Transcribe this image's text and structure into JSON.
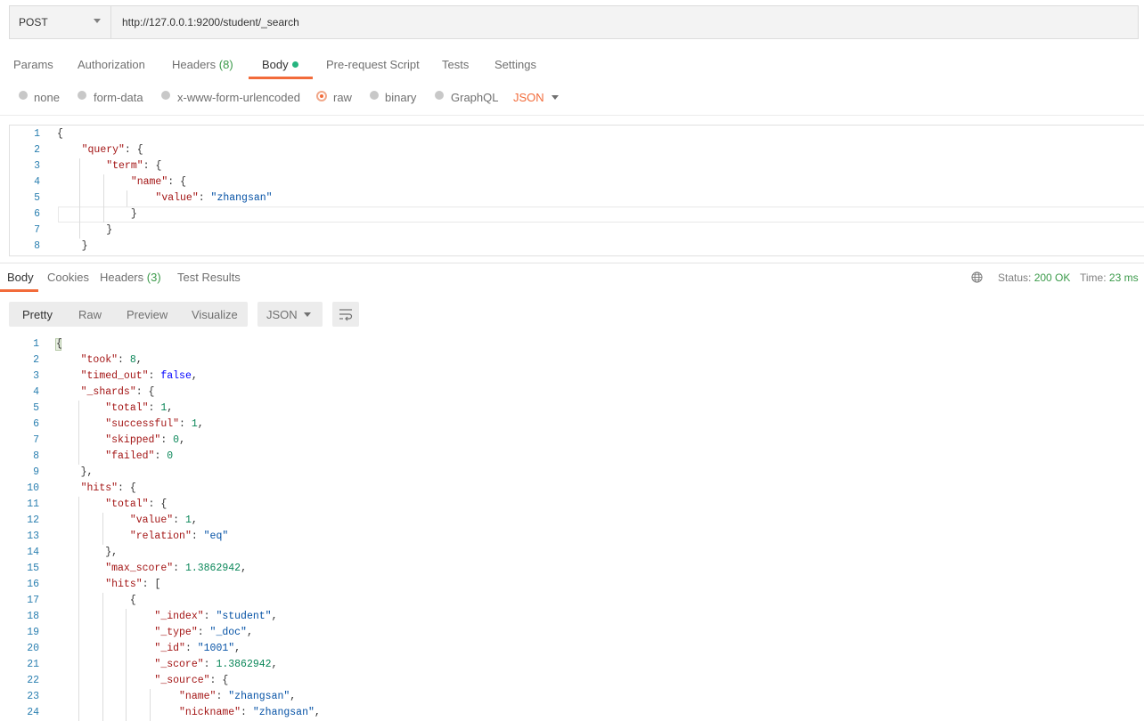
{
  "request": {
    "method": "POST",
    "url": "http://127.0.0.1:9200/student/_search",
    "tabs": [
      {
        "label": "Params"
      },
      {
        "label": "Authorization"
      },
      {
        "label": "Headers",
        "count": "(8)"
      },
      {
        "label": "Body"
      },
      {
        "label": "Pre-request Script"
      },
      {
        "label": "Tests"
      },
      {
        "label": "Settings"
      }
    ],
    "body_types": [
      "none",
      "form-data",
      "x-www-form-urlencoded",
      "raw",
      "binary",
      "GraphQL"
    ],
    "selected_body_type": "raw",
    "format": "JSON",
    "code_lines": [
      "{",
      "    \"query\": {",
      "        \"term\": {",
      "            \"name\": {",
      "                \"value\": \"zhangsan\"",
      "            }",
      "        }",
      "    }"
    ]
  },
  "response": {
    "tabs": [
      {
        "label": "Body"
      },
      {
        "label": "Cookies"
      },
      {
        "label": "Headers",
        "count": "(3)"
      },
      {
        "label": "Test Results"
      }
    ],
    "status_label": "Status:",
    "status_value": "200 OK",
    "time_label": "Time:",
    "time_value": "23 ms",
    "view_modes": [
      "Pretty",
      "Raw",
      "Preview",
      "Visualize"
    ],
    "format": "JSON",
    "code_lines": [
      "{",
      "    \"took\": 8,",
      "    \"timed_out\": false,",
      "    \"_shards\": {",
      "        \"total\": 1,",
      "        \"successful\": 1,",
      "        \"skipped\": 0,",
      "        \"failed\": 0",
      "    },",
      "    \"hits\": {",
      "        \"total\": {",
      "            \"value\": 1,",
      "            \"relation\": \"eq\"",
      "        },",
      "        \"max_score\": 1.3862942,",
      "        \"hits\": [",
      "            {",
      "                \"_index\": \"student\",",
      "                \"_type\": \"_doc\",",
      "                \"_id\": \"1001\",",
      "                \"_score\": 1.3862942,",
      "                \"_source\": {",
      "                    \"name\": \"zhangsan\",",
      "                    \"nickname\": \"zhangsan\","
    ]
  },
  "icons": {
    "method_caret": "chevron-down-icon",
    "globe": "globe-icon",
    "wrap": "wrap-lines-icon"
  },
  "colors": {
    "accent": "#f26b3a",
    "status_ok": "#3b9a4a",
    "line_number": "#2a7fb0",
    "json_key": "#a31515",
    "json_string": "#0451a5",
    "json_number": "#098658",
    "json_literal": "#0000ff"
  }
}
